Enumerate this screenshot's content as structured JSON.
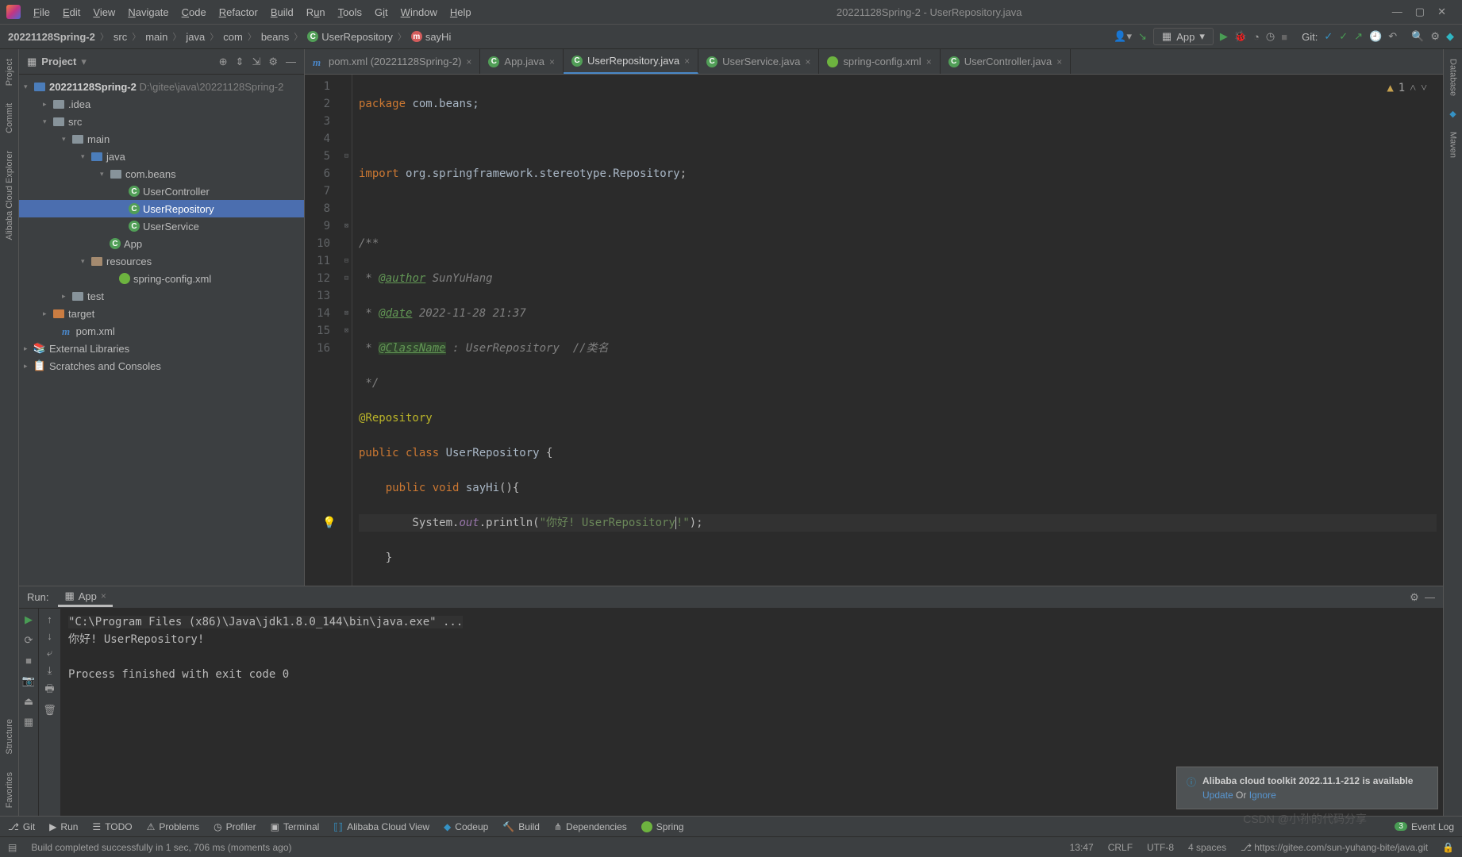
{
  "window_title": "20221128Spring-2 - UserRepository.java",
  "menus": [
    "File",
    "Edit",
    "View",
    "Navigate",
    "Code",
    "Refactor",
    "Build",
    "Run",
    "Tools",
    "Git",
    "Window",
    "Help"
  ],
  "breadcrumb": [
    "20221128Spring-2",
    "src",
    "main",
    "java",
    "com",
    "beans",
    "UserRepository",
    "sayHi"
  ],
  "run_config": "App",
  "git_label": "Git:",
  "project": {
    "panel_label": "Project",
    "root_name": "20221128Spring-2",
    "root_path": "D:\\gitee\\java\\20221128Spring-2",
    "nodes": {
      "idea": ".idea",
      "src": "src",
      "main": "main",
      "java": "java",
      "pkg": "com.beans",
      "uc": "UserController",
      "ur": "UserRepository",
      "us": "UserService",
      "app": "App",
      "resources": "resources",
      "spring_cfg": "spring-config.xml",
      "test": "test",
      "target": "target",
      "pom": "pom.xml",
      "ext_lib": "External Libraries",
      "scratches": "Scratches and Consoles"
    }
  },
  "tabs": [
    {
      "label": "pom.xml (20221128Spring-2)",
      "icon": "maven"
    },
    {
      "label": "App.java",
      "icon": "class"
    },
    {
      "label": "UserRepository.java",
      "icon": "class",
      "active": true
    },
    {
      "label": "UserService.java",
      "icon": "class"
    },
    {
      "label": "spring-config.xml",
      "icon": "spring"
    },
    {
      "label": "UserController.java",
      "icon": "class"
    }
  ],
  "warn_count": "1",
  "code": {
    "l1a": "package",
    "l1b": " com.beans;",
    "l3a": "import",
    "l3b": " org.springframework.stereotype.",
    "l3c": "Repository",
    "l3d": ";",
    "l5": "/**",
    "l6a": " * ",
    "l6b": "@author",
    "l6c": " SunYuHang",
    "l7a": " * ",
    "l7b": "@date",
    "l7c": " 2022-11-28 21:37",
    "l8a": " * ",
    "l8b": "@ClassName",
    "l8c": " : UserRepository  //类名",
    "l9": " */",
    "l10": "@Repository",
    "l11a": "public class ",
    "l11b": "UserRepository ",
    "l11c": "{",
    "l12a": "    public void ",
    "l12b": "sayHi",
    "l12c": "(){",
    "l13a": "        System.",
    "l13b": "out",
    "l13c": ".println(",
    "l13d": "\"你好! UserRepository",
    "l13e": "!\"",
    "l13f": ");",
    "l14": "    }",
    "l15": "}"
  },
  "run": {
    "label": "Run:",
    "tab": "App",
    "invoc": "\"C:\\Program Files (x86)\\Java\\jdk1.8.0_144\\bin\\java.exe\" ...",
    "out1": "你好! UserRepository!",
    "out2": "Process finished with exit code 0"
  },
  "bottombar": {
    "git": "Git",
    "run": "Run",
    "todo": "TODO",
    "problems": "Problems",
    "profiler": "Profiler",
    "terminal": "Terminal",
    "acv": "Alibaba Cloud View",
    "codeup": "Codeup",
    "build": "Build",
    "deps": "Dependencies",
    "spring": "Spring",
    "eventlog": "Event Log",
    "eventcount": "3"
  },
  "status": {
    "msg": "Build completed successfully in 1 sec, 706 ms (moments ago)",
    "time": "13:47",
    "eol": "CRLF",
    "enc": "UTF-8",
    "indent": "4 spaces",
    "branch": "https://gitee.com/sun-yuhang-bite/java.git"
  },
  "left_rail": [
    "Project",
    "Commit",
    "Alibaba Cloud Explorer"
  ],
  "left_rail_bottom": [
    "Structure",
    "Favorites"
  ],
  "right_rail": [
    "Database",
    "Maven"
  ],
  "notif": {
    "title": "Alibaba cloud toolkit 2022.11.1-212 is available",
    "update": "Update",
    "or": " Or ",
    "ignore": "Ignore"
  },
  "watermark": "CSDN @小孙的代码分享"
}
